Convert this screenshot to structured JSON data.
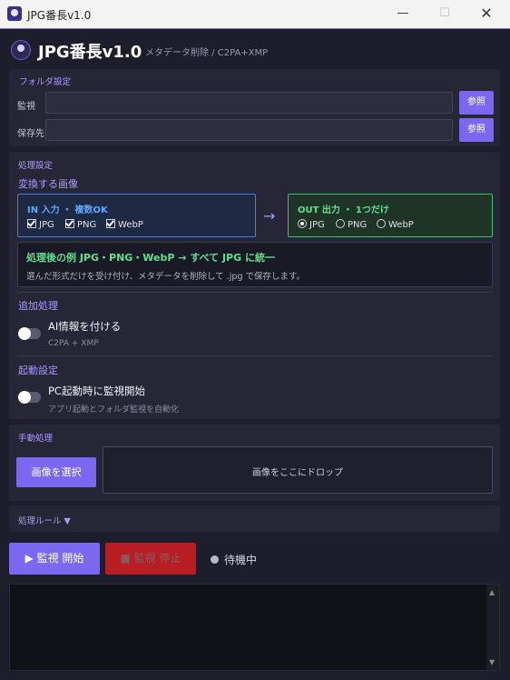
{
  "window": {
    "title": "JPG番長v1.0",
    "min": "—",
    "max": "☐",
    "close": "✕"
  },
  "header": {
    "title": "JPG番長v1.0",
    "subtitle": "メタデータ削除 / C2PA+XMP"
  },
  "folder": {
    "section": "フォルダ設定",
    "watch_label": "監視",
    "watch_value": "",
    "save_label": "保存先",
    "save_value": "",
    "browse": "参照"
  },
  "processing": {
    "section": "処理設定",
    "convert_title": "変換する画像",
    "input": {
      "title": "IN 入力 ・ 複数OK",
      "options": [
        "JPG",
        "PNG",
        "WebP"
      ]
    },
    "arrow": "→",
    "output": {
      "title": "OUT 出力 ・ 1つだけ",
      "options": [
        "JPG",
        "PNG",
        "WebP"
      ],
      "selected": "JPG"
    },
    "example_title": "処理後の例 JPG・PNG・WebP → すべて JPG に統一",
    "example_desc": "選んだ形式だけを受け付け、メタデータを削除して .jpg で保存します。",
    "extra_title": "追加処理",
    "ai_title": "AI情報を付ける",
    "ai_sub": "C2PA + XMP",
    "startup_title": "起動設定",
    "startup_toggle": "PC起動時に監視開始",
    "startup_sub": "アプリ起動とフォルダ監視を自動化"
  },
  "manual": {
    "section": "手動処理",
    "select_button": "画像を選択",
    "dropzone": "画像をここにドロップ"
  },
  "rules": {
    "label": "処理ルール ▼"
  },
  "controls": {
    "start": "▶ 監視 開始",
    "stop": "■ 監視 停止",
    "status": "待機中"
  },
  "log": {
    "scroll_up": "▲",
    "scroll_down": "▼"
  },
  "colors": {
    "accent": "#7b67f0",
    "stop": "#b81d24",
    "input_border": "#3e7fe0",
    "output_border": "#3fbf72"
  }
}
